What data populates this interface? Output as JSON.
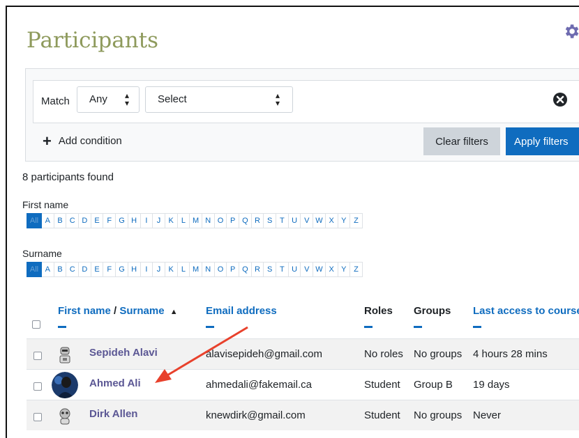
{
  "page": {
    "title": "Participants",
    "settings_icon": "gear-icon"
  },
  "filters": {
    "match_label": "Match",
    "match_value": "Any",
    "condition_value": "Select",
    "remove_icon": "close-circle-icon",
    "add_condition": "Add condition",
    "clear_label": "Clear filters",
    "apply_label": "Apply filters"
  },
  "results": {
    "count_text": "8 participants found"
  },
  "initials": {
    "firstname_label": "First name",
    "surname_label": "Surname",
    "letters": [
      "All",
      "A",
      "B",
      "C",
      "D",
      "E",
      "F",
      "G",
      "H",
      "I",
      "J",
      "K",
      "L",
      "M",
      "N",
      "O",
      "P",
      "Q",
      "R",
      "S",
      "T",
      "U",
      "V",
      "W",
      "X",
      "Y",
      "Z"
    ]
  },
  "table": {
    "columns": {
      "first_name": "First name",
      "separator": "/",
      "surname": "Surname",
      "email": "Email address",
      "roles": "Roles",
      "groups": "Groups",
      "last_access": "Last access to course"
    },
    "rows": [
      {
        "name": "Sepideh Alavi",
        "email": "alavisepideh@gmail.com",
        "roles": "No roles",
        "groups": "No groups",
        "last_access": "4 hours 28 mins"
      },
      {
        "name": "Ahmed Ali",
        "email": "ahmedali@fakemail.ca",
        "roles": "Student",
        "groups": "Group B",
        "last_access": "19 days"
      },
      {
        "name": "Dirk Allen",
        "email": "knewdirk@gmail.com",
        "roles": "Student",
        "groups": "No groups",
        "last_access": "Never"
      }
    ]
  },
  "colors": {
    "accent": "#0f6cbf",
    "title": "#8e9a5c",
    "name_link": "#5b5794",
    "annotation_arrow": "#e8412c"
  }
}
